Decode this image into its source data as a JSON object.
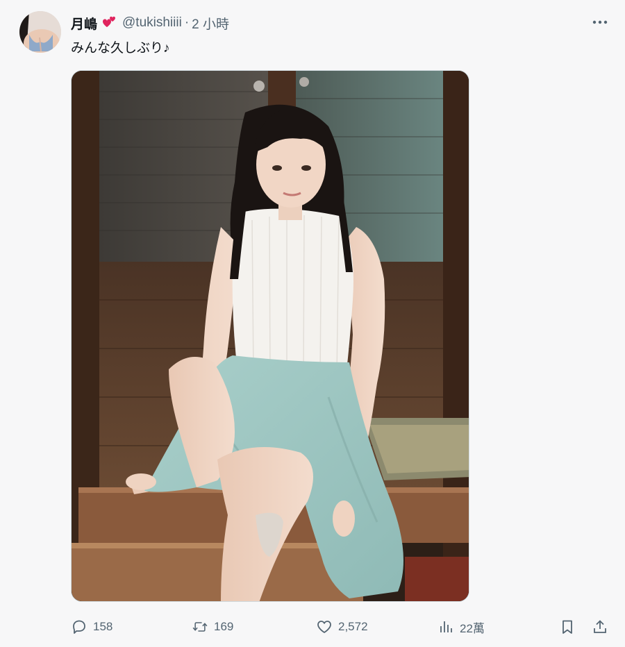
{
  "author": {
    "display_name": "月嶋",
    "emoji_icon": "two-hearts-icon",
    "handle": "@tukishiiii",
    "separator": "·",
    "time": "2 小時"
  },
  "tweet": {
    "text": "みんな久しぶり♪"
  },
  "actions": {
    "reply_count": "158",
    "retweet_count": "169",
    "like_count": "2,572",
    "views_count": "22萬"
  },
  "colors": {
    "text_primary": "#0f1419",
    "text_secondary": "#536471",
    "heart_red": "#e0245e"
  }
}
